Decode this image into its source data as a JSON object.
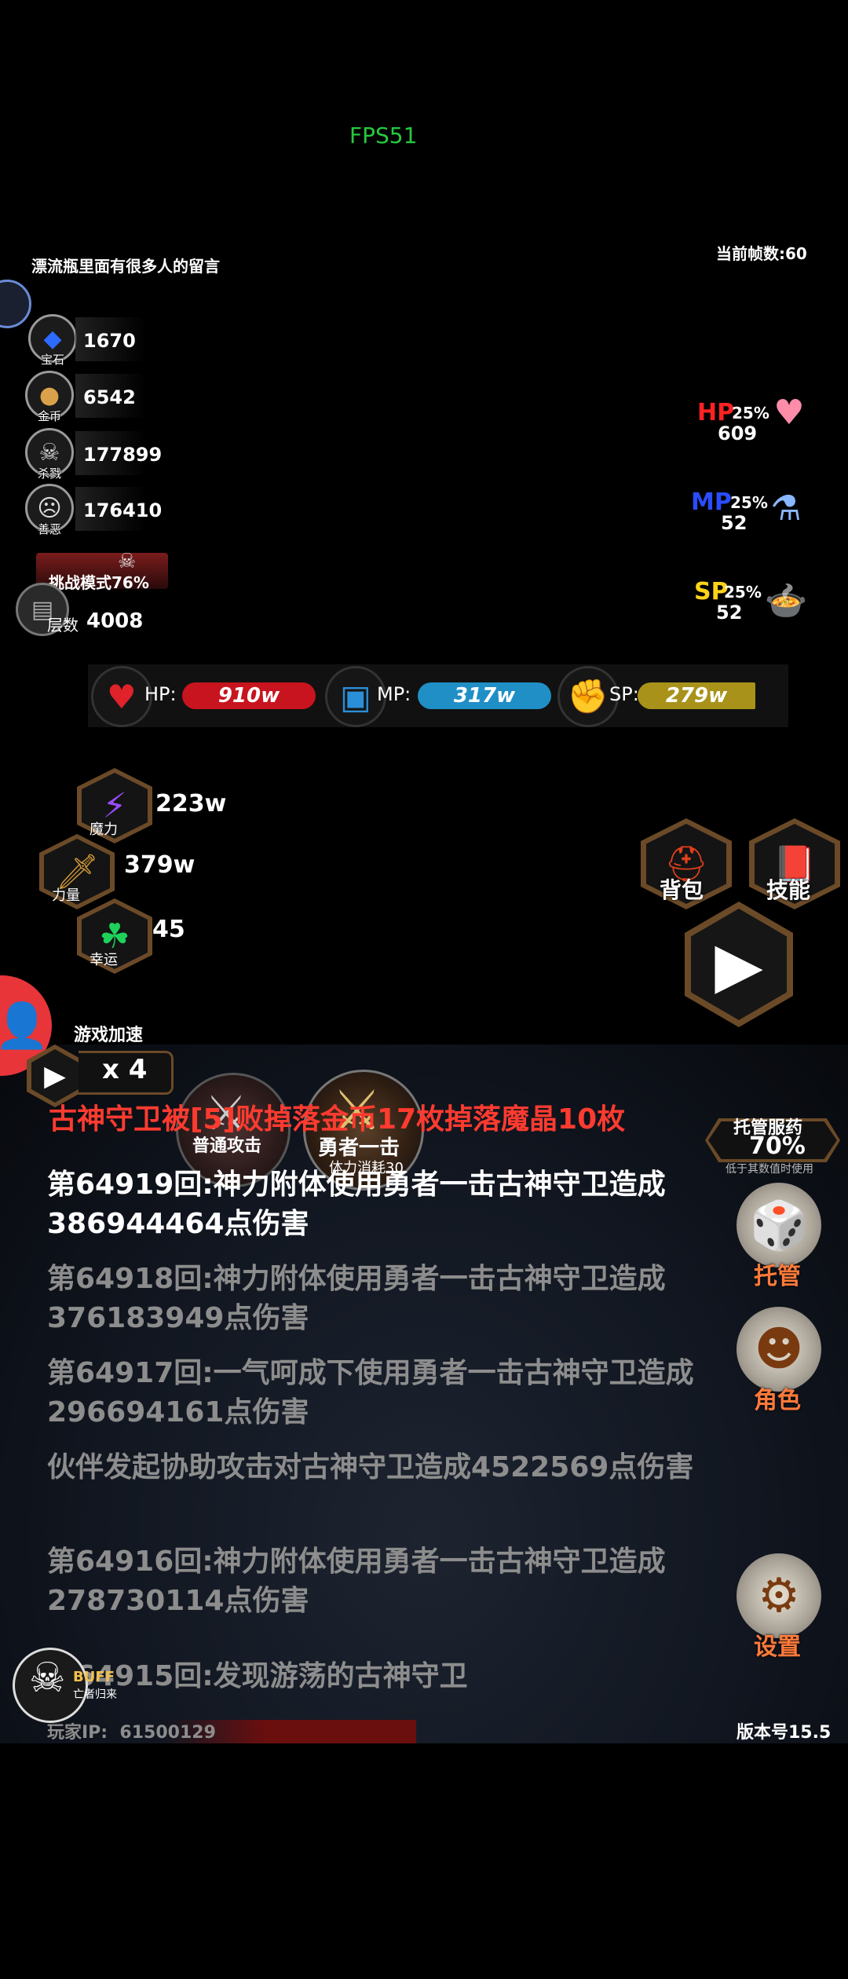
{
  "hud": {
    "fps_label": "FPS51",
    "message_tip": "漂流瓶里面有很多人的留言",
    "current_frames": "当前帧数:60"
  },
  "resources": [
    {
      "icon": "crystal-gem-icon",
      "caption": "宝石",
      "value": "1670"
    },
    {
      "icon": "gold-coin-icon",
      "caption": "金币",
      "value": "6542"
    },
    {
      "icon": "skull-kill-icon",
      "caption": "杀戮",
      "value": "177899"
    },
    {
      "icon": "evil-mask-icon",
      "caption": "善恶",
      "value": "176410"
    }
  ],
  "challenge": {
    "label": "挑战模式76%",
    "floor_caption": "层数",
    "floor_value": "4008"
  },
  "potions": {
    "hp": {
      "label": "HP",
      "pct": "25%",
      "count": "609",
      "color": "#ff2222"
    },
    "mp": {
      "label": "MP",
      "pct": "25%",
      "count": "52",
      "color": "#2a4cff"
    },
    "sp": {
      "label": "SP",
      "pct": "25%",
      "count": "52",
      "color": "#ffd21a"
    }
  },
  "stats": {
    "hp": {
      "label": "HP:",
      "value": "910w",
      "color": "#c8141e",
      "fill": 1.0
    },
    "mp": {
      "label": "MP:",
      "value": "317w",
      "color": "#1f8fc6",
      "fill": 1.0
    },
    "sp": {
      "label": "SP:",
      "value": "279w",
      "color": "#a89219",
      "fill": 1.0
    }
  },
  "attributes": [
    {
      "icon": "lightning-icon",
      "caption": "魔力",
      "value": "223w"
    },
    {
      "icon": "sword-icon",
      "caption": "力量",
      "value": "379w"
    },
    {
      "icon": "clover-icon",
      "caption": "幸运",
      "value": "45"
    }
  ],
  "menu": {
    "bag": "背包",
    "skills": "技能"
  },
  "speed": {
    "label": "游戏加速",
    "multiplier": "x 4"
  },
  "skills": {
    "normal_attack": "普通攻击",
    "hero_strike": "勇者一击",
    "hero_cost": "体力消耗30"
  },
  "banner": "古神守卫被[5]败掉落金币17枚掉落魔晶10枚",
  "auto_potion": {
    "label": "托管服药",
    "value": "70%",
    "sub": "低于其数值时使用"
  },
  "logs": [
    {
      "text": "第64919回:神力附体使用勇者一击古神守卫造成386944464点伤害",
      "color": "#ffffff"
    },
    {
      "text": "第64918回:神力附体使用勇者一击古神守卫造成376183949点伤害",
      "color": "#8d8d8d"
    },
    {
      "text": "第64917回:一气呵成下使用勇者一击古神守卫造成296694161点伤害",
      "color": "#8d8d8d"
    },
    {
      "text": "伙伴发起协助攻击对古神守卫造成4522569点伤害",
      "color": "#8d8d8d"
    },
    {
      "text": "第64916回:神力附体使用勇者一击古神守卫造成278730114点伤害",
      "color": "#8d8d8d"
    },
    {
      "text": "第64915回:发现游荡的古神守卫",
      "color": "#8d8d8d"
    }
  ],
  "side": {
    "auto": "托管",
    "role": "角色",
    "settings": "设置"
  },
  "buff": {
    "label": "BUFF",
    "sub": "亡者归来"
  },
  "footer": {
    "player_ip": "玩家IP:  61500129",
    "version": "版本号15.5"
  },
  "colors": {
    "banner": "#ff3b30",
    "accent_orange": "#ff7a3a",
    "fps_green": "#27c93f"
  }
}
